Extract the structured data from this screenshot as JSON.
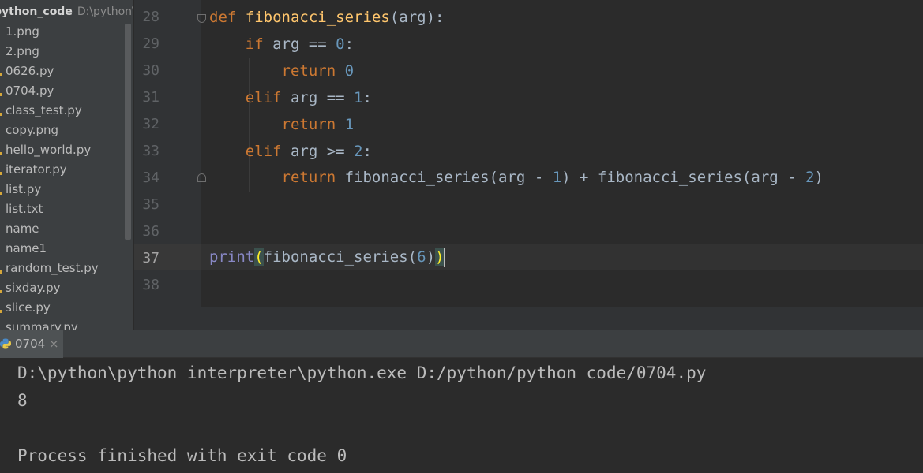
{
  "project": {
    "root_name": "python_code",
    "root_path": "D:\\python\\",
    "files": [
      {
        "name": "1.png",
        "is_python": false
      },
      {
        "name": "2.png",
        "is_python": false
      },
      {
        "name": "0626.py",
        "is_python": true
      },
      {
        "name": "0704.py",
        "is_python": true
      },
      {
        "name": "class_test.py",
        "is_python": true
      },
      {
        "name": "copy.png",
        "is_python": false
      },
      {
        "name": "hello_world.py",
        "is_python": true
      },
      {
        "name": "iterator.py",
        "is_python": true
      },
      {
        "name": "list.py",
        "is_python": true
      },
      {
        "name": "list.txt",
        "is_python": false
      },
      {
        "name": "name",
        "is_python": false
      },
      {
        "name": "name1",
        "is_python": false
      },
      {
        "name": "random_test.py",
        "is_python": true
      },
      {
        "name": "sixday.py",
        "is_python": true
      },
      {
        "name": "slice.py",
        "is_python": true
      },
      {
        "name": "summary.py",
        "is_python": true
      }
    ]
  },
  "editor": {
    "line_numbers": [
      "28",
      "29",
      "30",
      "31",
      "32",
      "33",
      "34",
      "35",
      "36",
      "37",
      "38"
    ],
    "active_line": "37",
    "code": {
      "l28": {
        "kw": "def",
        "fn": "fibonacci_series",
        "rest": "(arg):"
      },
      "l29": {
        "kw": "if",
        "mid": " arg == ",
        "num": "0",
        "end": ":"
      },
      "l30": {
        "kw": "return",
        "num": "0"
      },
      "l31": {
        "kw": "elif",
        "mid": " arg == ",
        "num": "1",
        "end": ":"
      },
      "l32": {
        "kw": "return",
        "num": "1"
      },
      "l33": {
        "kw": "elif",
        "mid": " arg >= ",
        "num": "2",
        "end": ":"
      },
      "l34": {
        "kw": "return",
        "a": " fibonacci_series(arg - ",
        "n1": "1",
        "b": ") + fibonacci_series(arg - ",
        "n2": "2",
        "c": ")"
      },
      "l37": {
        "bi": "print",
        "open": "(",
        "call": "fibonacci_series(",
        "num": "6",
        "close1": ")",
        "close2": ")"
      }
    }
  },
  "run": {
    "tab_label": "0704",
    "close_glyph": "×",
    "output": [
      "D:\\python\\python_interpreter\\python.exe D:/python/python_code/0704.py",
      "8",
      "",
      "Process finished with exit code 0"
    ]
  },
  "colors": {
    "keyword": "#cc7832",
    "function": "#ffc66d",
    "number": "#6897bb",
    "builtin": "#8888c6",
    "text": "#a9b7c6",
    "python_file_mark": "#d6a83b"
  }
}
